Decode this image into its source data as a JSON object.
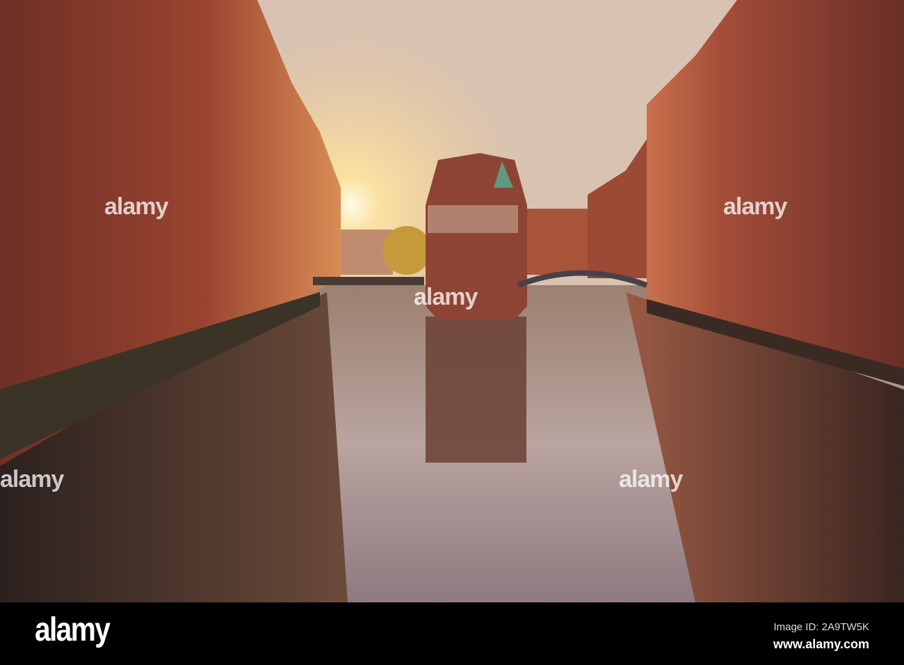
{
  "watermark": {
    "text": "alamy"
  },
  "footer": {
    "logo": "alamy",
    "image_id": "Image ID: 2A9TW5K",
    "website": "www.alamy.com"
  }
}
